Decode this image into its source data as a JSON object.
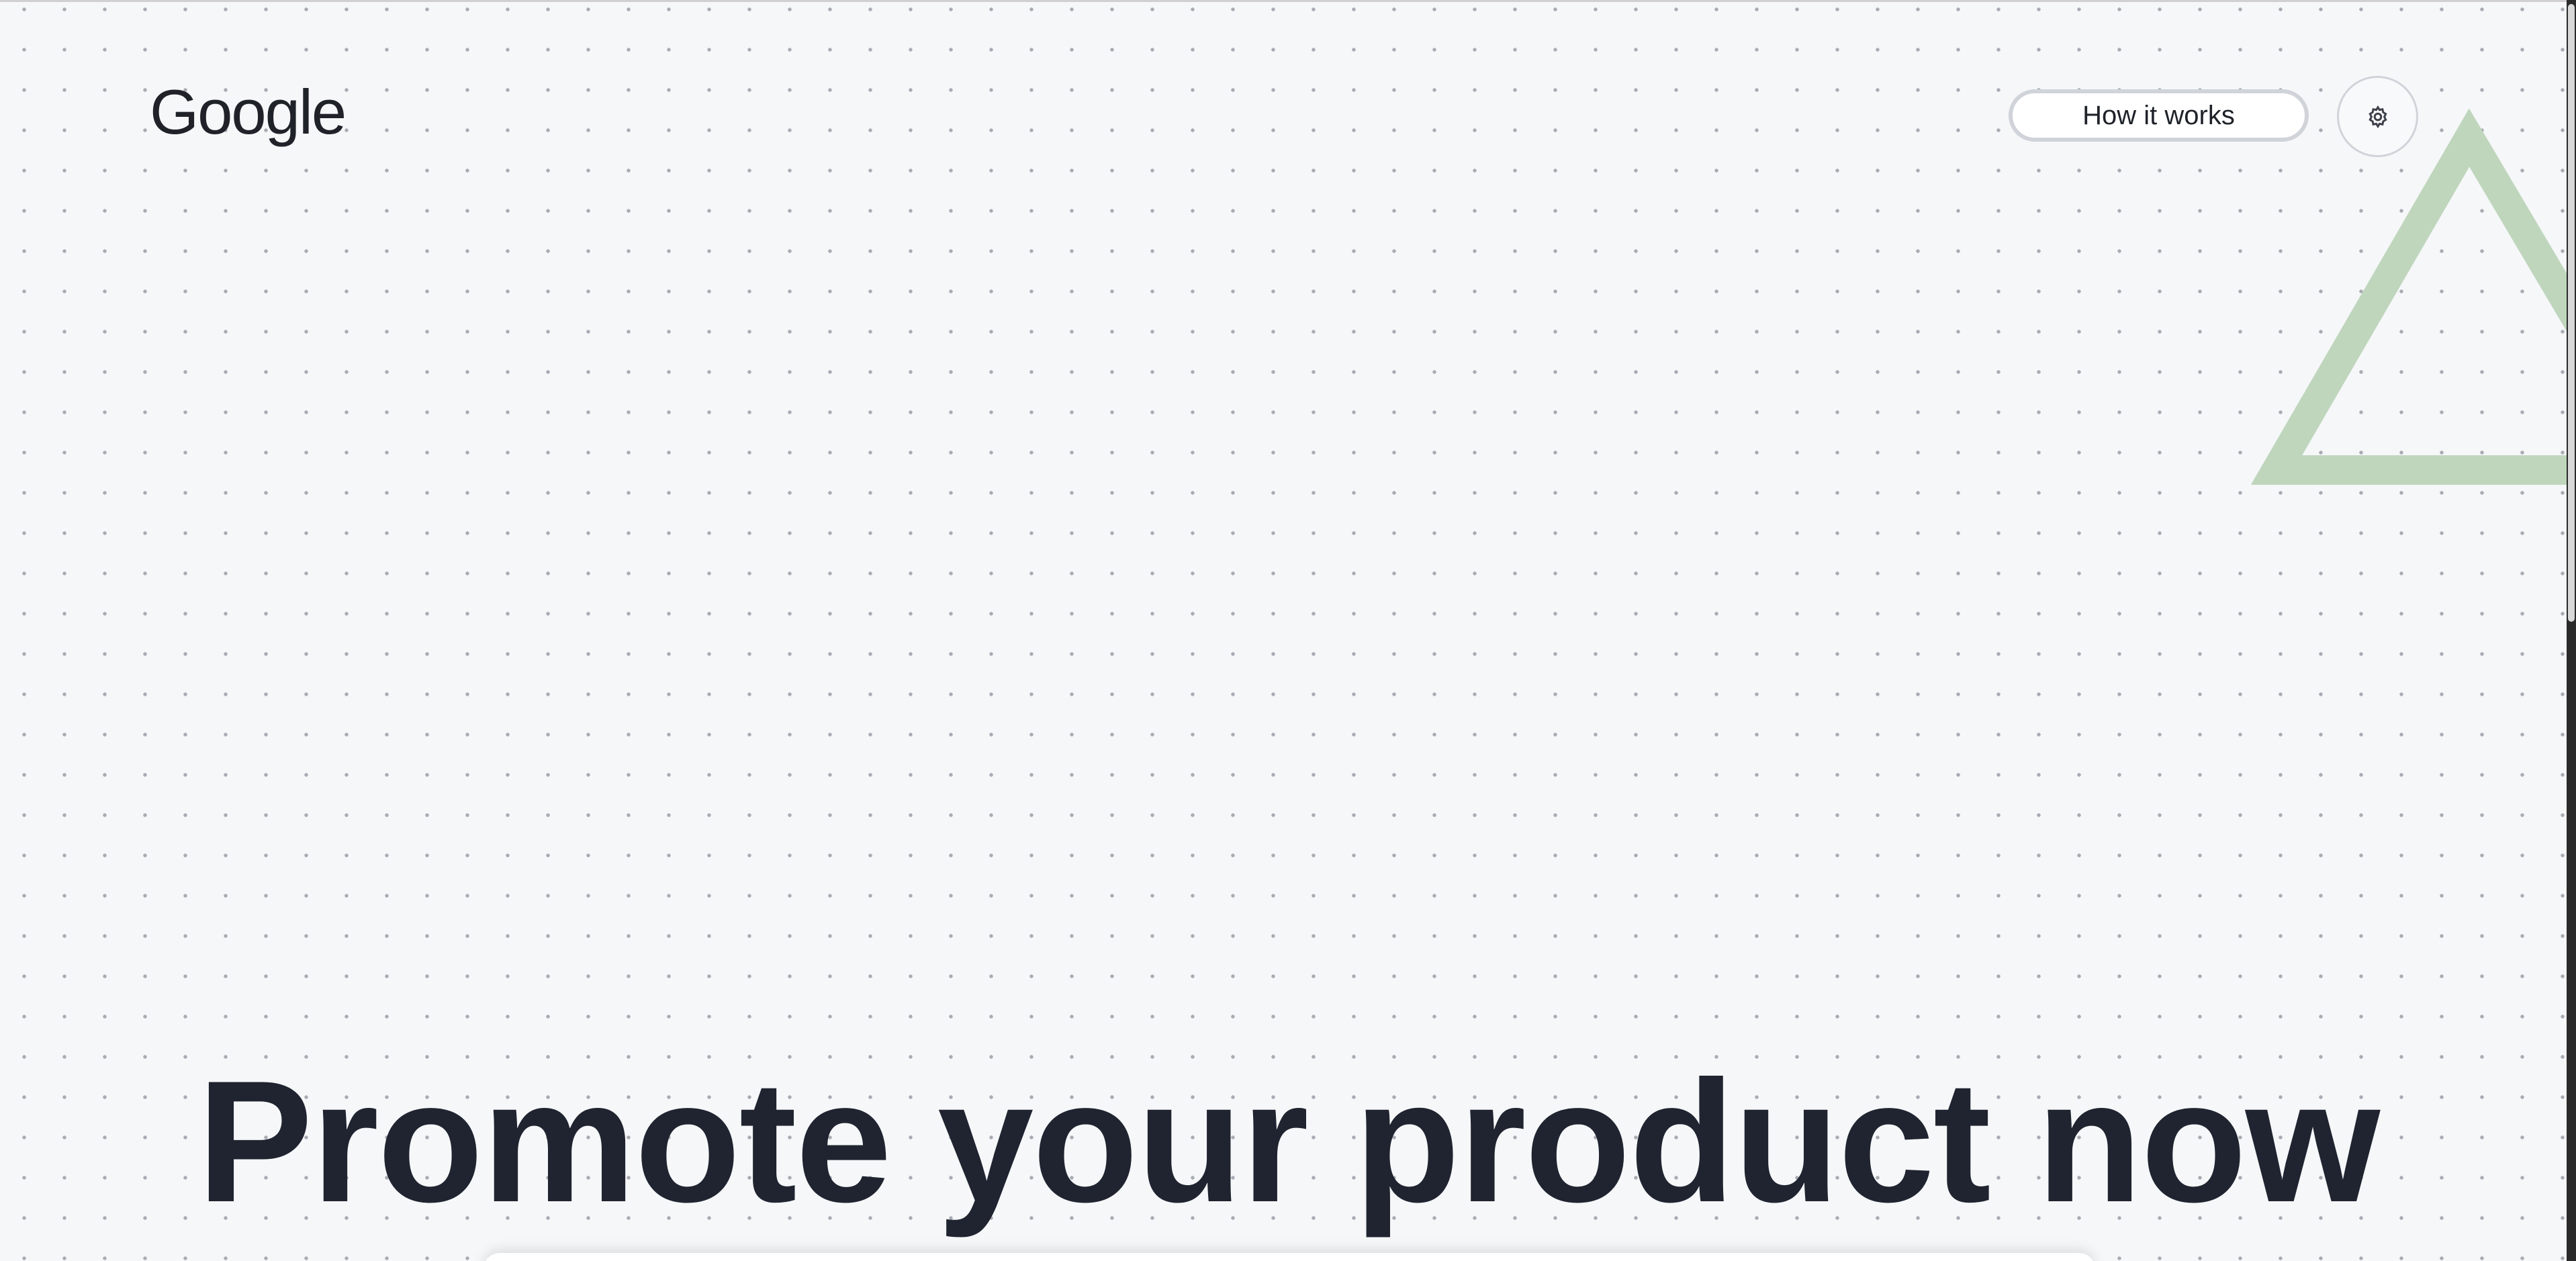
{
  "header": {
    "logo_text": "Google",
    "how_it_works_label": "How it works",
    "settings_icon": "gear-icon"
  },
  "hero": {
    "headline": "Promote your product now",
    "decoration": "triangle-outline",
    "decoration_color": "#bfd6bd"
  },
  "colors": {
    "background": "#f6f7f9",
    "dot": "#a8abb2",
    "text": "#1f2430",
    "button_border": "#d0d3d9"
  }
}
